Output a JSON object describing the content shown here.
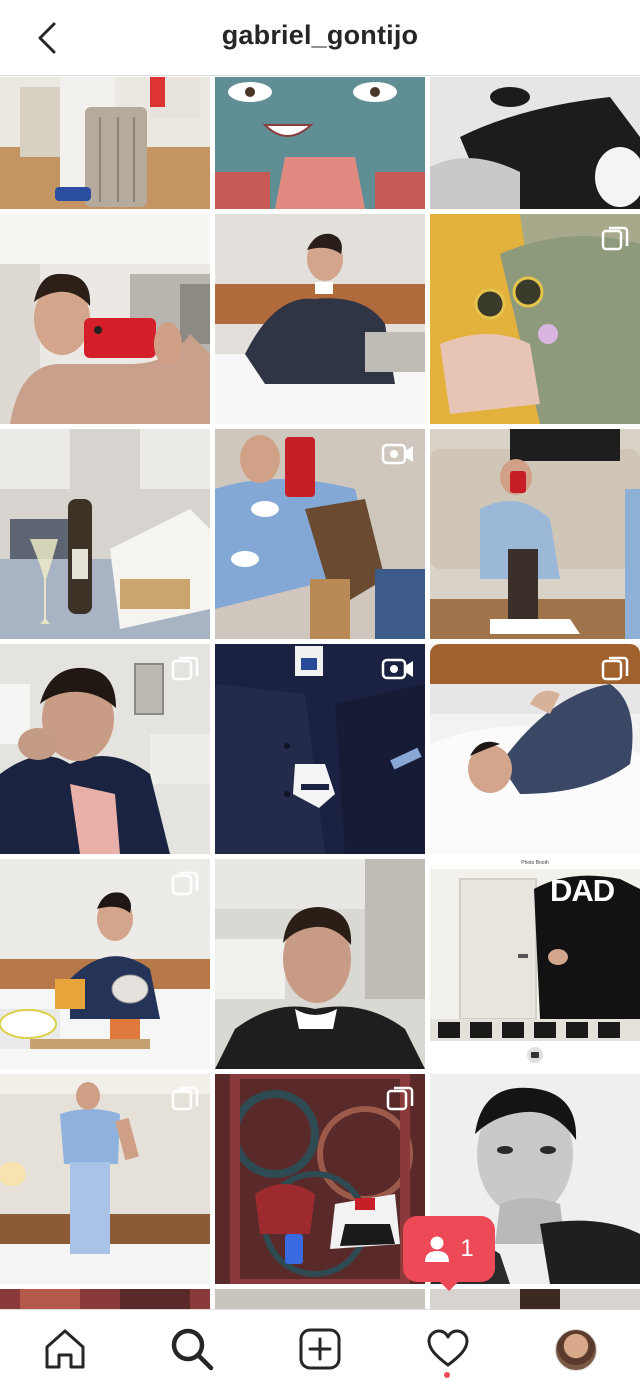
{
  "header": {
    "title": "gabriel_gontijo",
    "back_icon": "chevron-left-icon"
  },
  "grid": {
    "tiles": [
      {
        "id": "post-1",
        "badge": null,
        "palette": [
          "#c99a68",
          "#efece6",
          "#b0a49a"
        ]
      },
      {
        "id": "post-2",
        "badge": null,
        "palette": [
          "#e08a82",
          "#5f8f95",
          "#2d4e55"
        ]
      },
      {
        "id": "post-3",
        "badge": null,
        "palette": [
          "#e8e8e8",
          "#1e1e1e",
          "#8a8a8a"
        ]
      },
      {
        "id": "post-4",
        "badge": null,
        "palette": [
          "#e9e6e2",
          "#c8a08b",
          "#d41f2a"
        ]
      },
      {
        "id": "post-5",
        "badge": null,
        "palette": [
          "#dcd7d2",
          "#2f3545",
          "#eeeeee"
        ]
      },
      {
        "id": "post-6",
        "badge": "carousel-icon",
        "palette": [
          "#a7a98a",
          "#e8b840",
          "#e6c3b3"
        ]
      },
      {
        "id": "post-7",
        "badge": null,
        "palette": [
          "#d7d4cf",
          "#8ea2bb",
          "#3d3226"
        ]
      },
      {
        "id": "post-8",
        "badge": "video-icon",
        "palette": [
          "#cfc7bd",
          "#84a8d6",
          "#6a4a30"
        ]
      },
      {
        "id": "post-9",
        "badge": null,
        "palette": [
          "#d9d2c6",
          "#9cb8d8",
          "#3b2f2a"
        ]
      },
      {
        "id": "post-10",
        "badge": "carousel-icon",
        "palette": [
          "#e5e3e0",
          "#1a2340",
          "#c49b86"
        ]
      },
      {
        "id": "post-11",
        "badge": "video-icon",
        "palette": [
          "#1b2140",
          "#2a3155",
          "#f1f1f1"
        ]
      },
      {
        "id": "post-12",
        "badge": "carousel-icon",
        "palette": [
          "#f2f2f2",
          "#a0612d",
          "#3a4866"
        ]
      },
      {
        "id": "post-13",
        "badge": "carousel-icon",
        "palette": [
          "#ecebe8",
          "#263358",
          "#e7a43b"
        ]
      },
      {
        "id": "post-14",
        "badge": null,
        "palette": [
          "#dad8d3",
          "#1e1e1e",
          "#c79b86"
        ]
      },
      {
        "id": "post-15",
        "badge": null,
        "palette": [
          "#f3f1ec",
          "#121212",
          "#dddad3"
        ]
      },
      {
        "id": "post-16",
        "badge": "carousel-icon",
        "palette": [
          "#e6e1d8",
          "#8fb1de",
          "#5a4231"
        ]
      },
      {
        "id": "post-17",
        "badge": "carousel-icon",
        "palette": [
          "#5a2a2a",
          "#8a3a3a",
          "#2e4a52"
        ]
      },
      {
        "id": "post-18",
        "badge": null,
        "palette": [
          "#efefef",
          "#1f1f1f",
          "#9a9a9a"
        ]
      }
    ],
    "post_15_overlay": {
      "top_caption": "Photo Booth",
      "shirt_text": "DAD"
    }
  },
  "activity_notification": {
    "icon": "person-icon",
    "count": "1",
    "color": "#ed4956"
  },
  "bottom_nav": {
    "items": [
      {
        "name": "home",
        "icon": "home-icon"
      },
      {
        "name": "search",
        "icon": "search-icon",
        "active": true
      },
      {
        "name": "new-post",
        "icon": "plus-square-icon"
      },
      {
        "name": "activity",
        "icon": "heart-icon",
        "has_dot": true
      },
      {
        "name": "profile",
        "icon": "avatar"
      }
    ]
  },
  "colors": {
    "accent": "#ed4956",
    "text": "#262626",
    "divider": "#dbdbdb"
  }
}
